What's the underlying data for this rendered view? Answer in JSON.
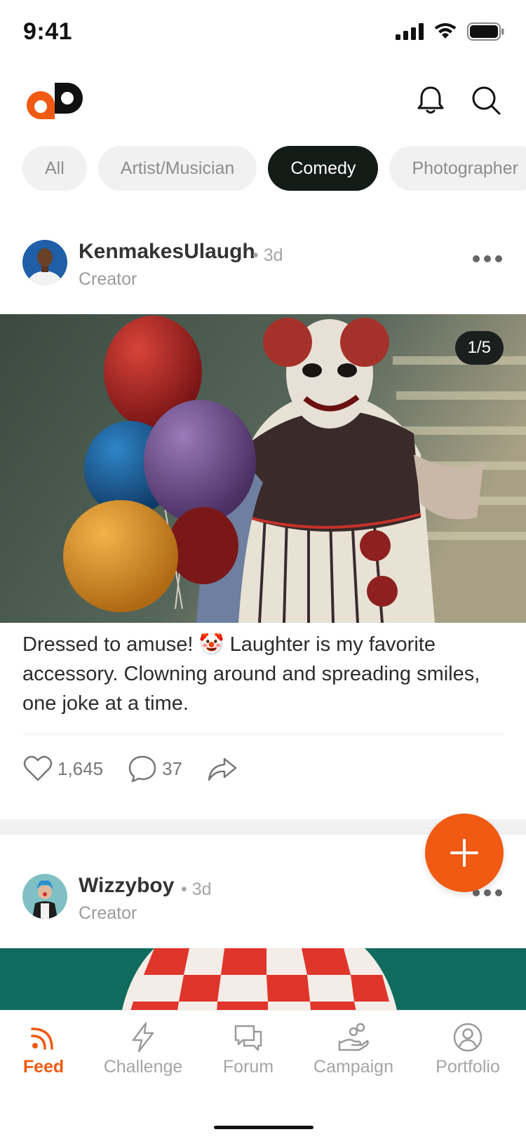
{
  "status_bar": {
    "time": "9:41"
  },
  "header": {
    "logo_icon": "brand-logo",
    "bell_icon": "bell-icon",
    "search_icon": "search-icon"
  },
  "categories": [
    {
      "label": "All",
      "active": false
    },
    {
      "label": "Artist/Musician",
      "active": false
    },
    {
      "label": "Comedy",
      "active": true
    },
    {
      "label": "Photographer",
      "active": false
    }
  ],
  "posts": [
    {
      "user_name": "KenmakesUlaugh",
      "time": "• 3d",
      "role": "Creator",
      "media_counter": "1/5",
      "caption": "Dressed to amuse! 🤡 Laughter is my favorite accessory. Clowning around and spreading smiles, one joke at a time.",
      "likes": "1,645",
      "comments": "37"
    },
    {
      "user_name": "Wizzyboy",
      "time": "• 3d",
      "role": "Creator"
    }
  ],
  "fab": {
    "icon": "plus-icon"
  },
  "tabs": [
    {
      "label": "Feed",
      "icon": "rss-icon",
      "active": true
    },
    {
      "label": "Challenge",
      "icon": "lightning-icon",
      "active": false
    },
    {
      "label": "Forum",
      "icon": "chat-bubbles-icon",
      "active": false
    },
    {
      "label": "Campaign",
      "icon": "hand-coins-icon",
      "active": false
    },
    {
      "label": "Portfolio",
      "icon": "user-circle-icon",
      "active": false
    }
  ],
  "colors": {
    "accent": "#f05a12",
    "chip_active": "#141c18",
    "chip_inactive": "#f1f1f1"
  }
}
